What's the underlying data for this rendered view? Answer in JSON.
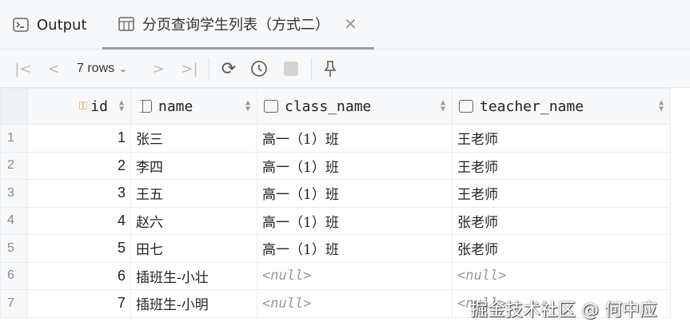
{
  "tabs": [
    {
      "label": "Output",
      "icon": "console-icon"
    },
    {
      "label": "分页查询学生列表（方式二）",
      "icon": "table-icon",
      "active": true
    }
  ],
  "toolbar": {
    "rows_label": "7 rows"
  },
  "columns": [
    {
      "name": "id",
      "icon": "primary-key-icon"
    },
    {
      "name": "name"
    },
    {
      "name": "class_name"
    },
    {
      "name": "teacher_name"
    }
  ],
  "rows": [
    {
      "n": "1",
      "id": "1",
      "name": "张三",
      "class_name": "高一（1）班",
      "teacher_name": "王老师"
    },
    {
      "n": "2",
      "id": "2",
      "name": "李四",
      "class_name": "高一（1）班",
      "teacher_name": "王老师"
    },
    {
      "n": "3",
      "id": "3",
      "name": "王五",
      "class_name": "高一（1）班",
      "teacher_name": "王老师"
    },
    {
      "n": "4",
      "id": "4",
      "name": "赵六",
      "class_name": "高一（1）班",
      "teacher_name": "张老师"
    },
    {
      "n": "5",
      "id": "5",
      "name": "田七",
      "class_name": "高一（1）班",
      "teacher_name": "张老师"
    },
    {
      "n": "6",
      "id": "6",
      "name": "插班生-小壮",
      "class_name": "<null>",
      "teacher_name": "<null>"
    },
    {
      "n": "7",
      "id": "7",
      "name": "插班生-小明",
      "class_name": "<null>",
      "teacher_name": "<null>"
    }
  ],
  "watermark": "掘金技术社区 @ 何中应"
}
